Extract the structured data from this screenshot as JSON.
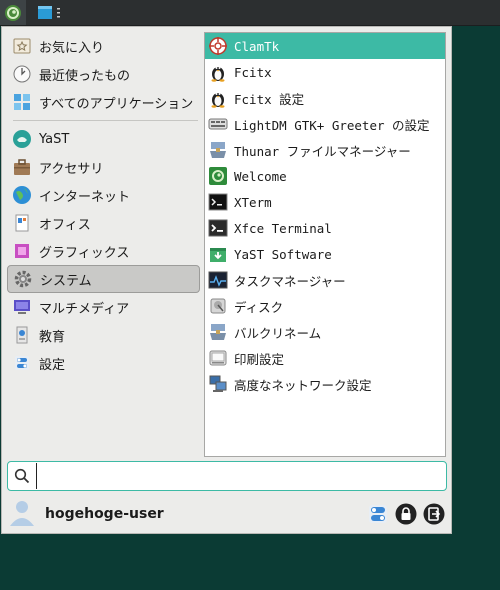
{
  "panel": {
    "menu_icon": "opensuse-menu-icon",
    "task_icon": "window-icon"
  },
  "categories": [
    {
      "label": "お気に入り",
      "icon": "favorites-icon"
    },
    {
      "label": "最近使ったもの",
      "icon": "clock-icon"
    },
    {
      "label": "すべてのアプリケーション",
      "icon": "all-apps-icon"
    },
    {
      "label": "YaST",
      "icon": "yast-icon"
    },
    {
      "label": "アクセサリ",
      "icon": "accessories-icon"
    },
    {
      "label": "インターネット",
      "icon": "globe-icon"
    },
    {
      "label": "オフィス",
      "icon": "office-icon"
    },
    {
      "label": "グラフィックス",
      "icon": "graphics-icon"
    },
    {
      "label": "システム",
      "icon": "gear-icon",
      "selected": true
    },
    {
      "label": "マルチメディア",
      "icon": "multimedia-icon"
    },
    {
      "label": "教育",
      "icon": "education-icon"
    },
    {
      "label": "設定",
      "icon": "settings-icon"
    }
  ],
  "apps": [
    {
      "label": "ClamTk",
      "icon": "clamtk-icon",
      "selected": true
    },
    {
      "label": "Fcitx",
      "icon": "tux-icon"
    },
    {
      "label": "Fcitx 設定",
      "icon": "tux-icon"
    },
    {
      "label": "LightDM GTK+ Greeter の設定",
      "icon": "lightdm-icon"
    },
    {
      "label": "Thunar ファイルマネージャー",
      "icon": "thunar-icon"
    },
    {
      "label": "Welcome",
      "icon": "welcome-icon"
    },
    {
      "label": "XTerm",
      "icon": "xterm-icon"
    },
    {
      "label": "Xfce Terminal",
      "icon": "terminal-icon"
    },
    {
      "label": "YaST Software",
      "icon": "yast-software-icon"
    },
    {
      "label": "タスクマネージャー",
      "icon": "task-manager-icon"
    },
    {
      "label": "ディスク",
      "icon": "disk-icon"
    },
    {
      "label": "バルクリネーム",
      "icon": "bulk-rename-icon"
    },
    {
      "label": "印刷設定",
      "icon": "printer-icon"
    },
    {
      "label": "高度なネットワーク設定",
      "icon": "network-icon"
    }
  ],
  "search": {
    "value": "",
    "placeholder": ""
  },
  "footer": {
    "username": "hogehoge-user",
    "buttons": [
      "settings-icon",
      "lock-icon",
      "logout-icon"
    ]
  },
  "colors": {
    "accent": "#3dbaa5",
    "desktop": "#0b3b34",
    "panel": "#2c2f30"
  }
}
